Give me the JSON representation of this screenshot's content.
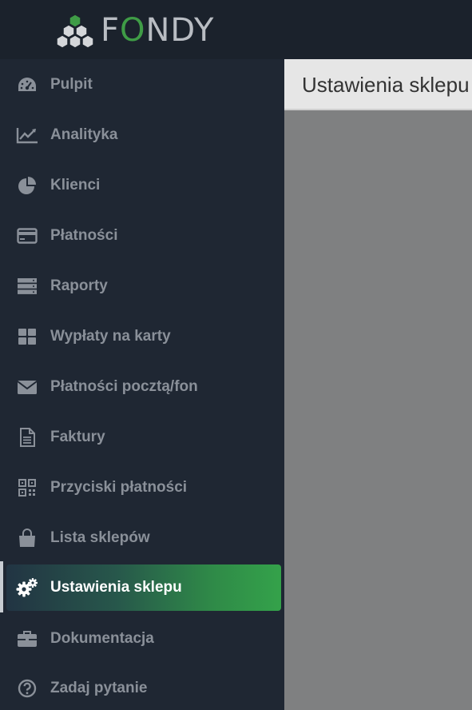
{
  "brand": {
    "name_prefix": "F",
    "name_o": "O",
    "name_suffix": "NDY"
  },
  "colors": {
    "accent_green": "#3f9c46",
    "sidebar_bg": "#1f2733",
    "content_bg": "#7f8081"
  },
  "sidebar": {
    "items": [
      {
        "label": "Pulpit",
        "icon": "dashboard-icon"
      },
      {
        "label": "Analityka",
        "icon": "line-chart-icon"
      },
      {
        "label": "Klienci",
        "icon": "pie-chart-icon"
      },
      {
        "label": "Płatności",
        "icon": "credit-card-icon"
      },
      {
        "label": "Raporty",
        "icon": "server-icon"
      },
      {
        "label": "Wypłaty na karty",
        "icon": "grid-icon"
      },
      {
        "label": "Płatności pocztą/fon",
        "icon": "envelope-icon"
      },
      {
        "label": "Faktury",
        "icon": "document-icon"
      },
      {
        "label": "Przyciski płatności",
        "icon": "qr-code-icon"
      },
      {
        "label": "Lista sklepów",
        "icon": "shopping-bag-icon"
      },
      {
        "label": "Ustawienia sklepu",
        "icon": "gears-icon",
        "active": true
      },
      {
        "label": "Dokumentacja",
        "icon": "briefcase-icon"
      },
      {
        "label": "Zadaj pytanie",
        "icon": "question-circle-icon"
      }
    ]
  },
  "main": {
    "title": "Ustawienia sklepu"
  }
}
